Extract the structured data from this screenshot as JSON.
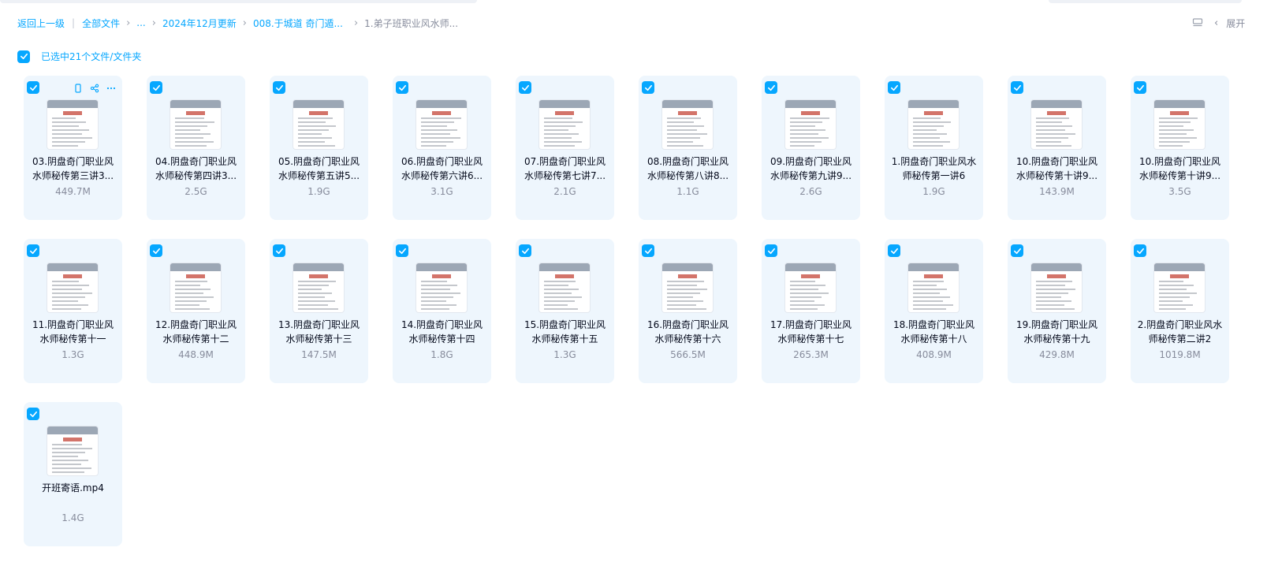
{
  "breadcrumb": {
    "back": "返回上一级",
    "separator": "|",
    "items": [
      "全部文件",
      "...",
      "2024年12月更新",
      "008.于城道 奇门遁..."
    ],
    "current": "1.弟子班职业风水师..."
  },
  "toolbar": {
    "expand_label": "展开"
  },
  "selection": {
    "label": "已选中21个文件/文件夹"
  },
  "colors": {
    "accent": "#06a7ff",
    "card_bg": "#eef6fd",
    "muted": "#878c9c"
  },
  "files": [
    {
      "name": "03.阴盘奇门职业风水师秘传第三讲3...",
      "size": "449.7M"
    },
    {
      "name": "04.阴盘奇门职业风水师秘传第四讲3...",
      "size": "2.5G"
    },
    {
      "name": "05.阴盘奇门职业风水师秘传第五讲5...",
      "size": "1.9G"
    },
    {
      "name": "06.阴盘奇门职业风水师秘传第六讲6...",
      "size": "3.1G"
    },
    {
      "name": "07.阴盘奇门职业风水师秘传第七讲7...",
      "size": "2.1G"
    },
    {
      "name": "08.阴盘奇门职业风水师秘传第八讲8...",
      "size": "1.1G"
    },
    {
      "name": "09.阴盘奇门职业风水师秘传第九讲9...",
      "size": "2.6G"
    },
    {
      "name": "1.阴盘奇门职业风水师秘传第一讲6",
      "size": "1.9G"
    },
    {
      "name": "10.阴盘奇门职业风水师秘传第十讲9...",
      "size": "143.9M"
    },
    {
      "name": "10.阴盘奇门职业风水师秘传第十讲9...",
      "size": "3.5G"
    },
    {
      "name": "11.阴盘奇门职业风水师秘传第十一",
      "size": "1.3G"
    },
    {
      "name": "12.阴盘奇门职业风水师秘传第十二",
      "size": "448.9M"
    },
    {
      "name": "13.阴盘奇门职业风水师秘传第十三",
      "size": "147.5M"
    },
    {
      "name": "14.阴盘奇门职业风水师秘传第十四",
      "size": "1.8G"
    },
    {
      "name": "15.阴盘奇门职业风水师秘传第十五",
      "size": "1.3G"
    },
    {
      "name": "16.阴盘奇门职业风水师秘传第十六",
      "size": "566.5M"
    },
    {
      "name": "17.阴盘奇门职业风水师秘传第十七",
      "size": "265.3M"
    },
    {
      "name": "18.阴盘奇门职业风水师秘传第十八",
      "size": "408.9M"
    },
    {
      "name": "19.阴盘奇门职业风水师秘传第十九",
      "size": "429.8M"
    },
    {
      "name": "2.阴盘奇门职业风水师秘传第二讲2",
      "size": "1019.8M"
    },
    {
      "name": "开班寄语.mp4",
      "size": "1.4G"
    }
  ]
}
